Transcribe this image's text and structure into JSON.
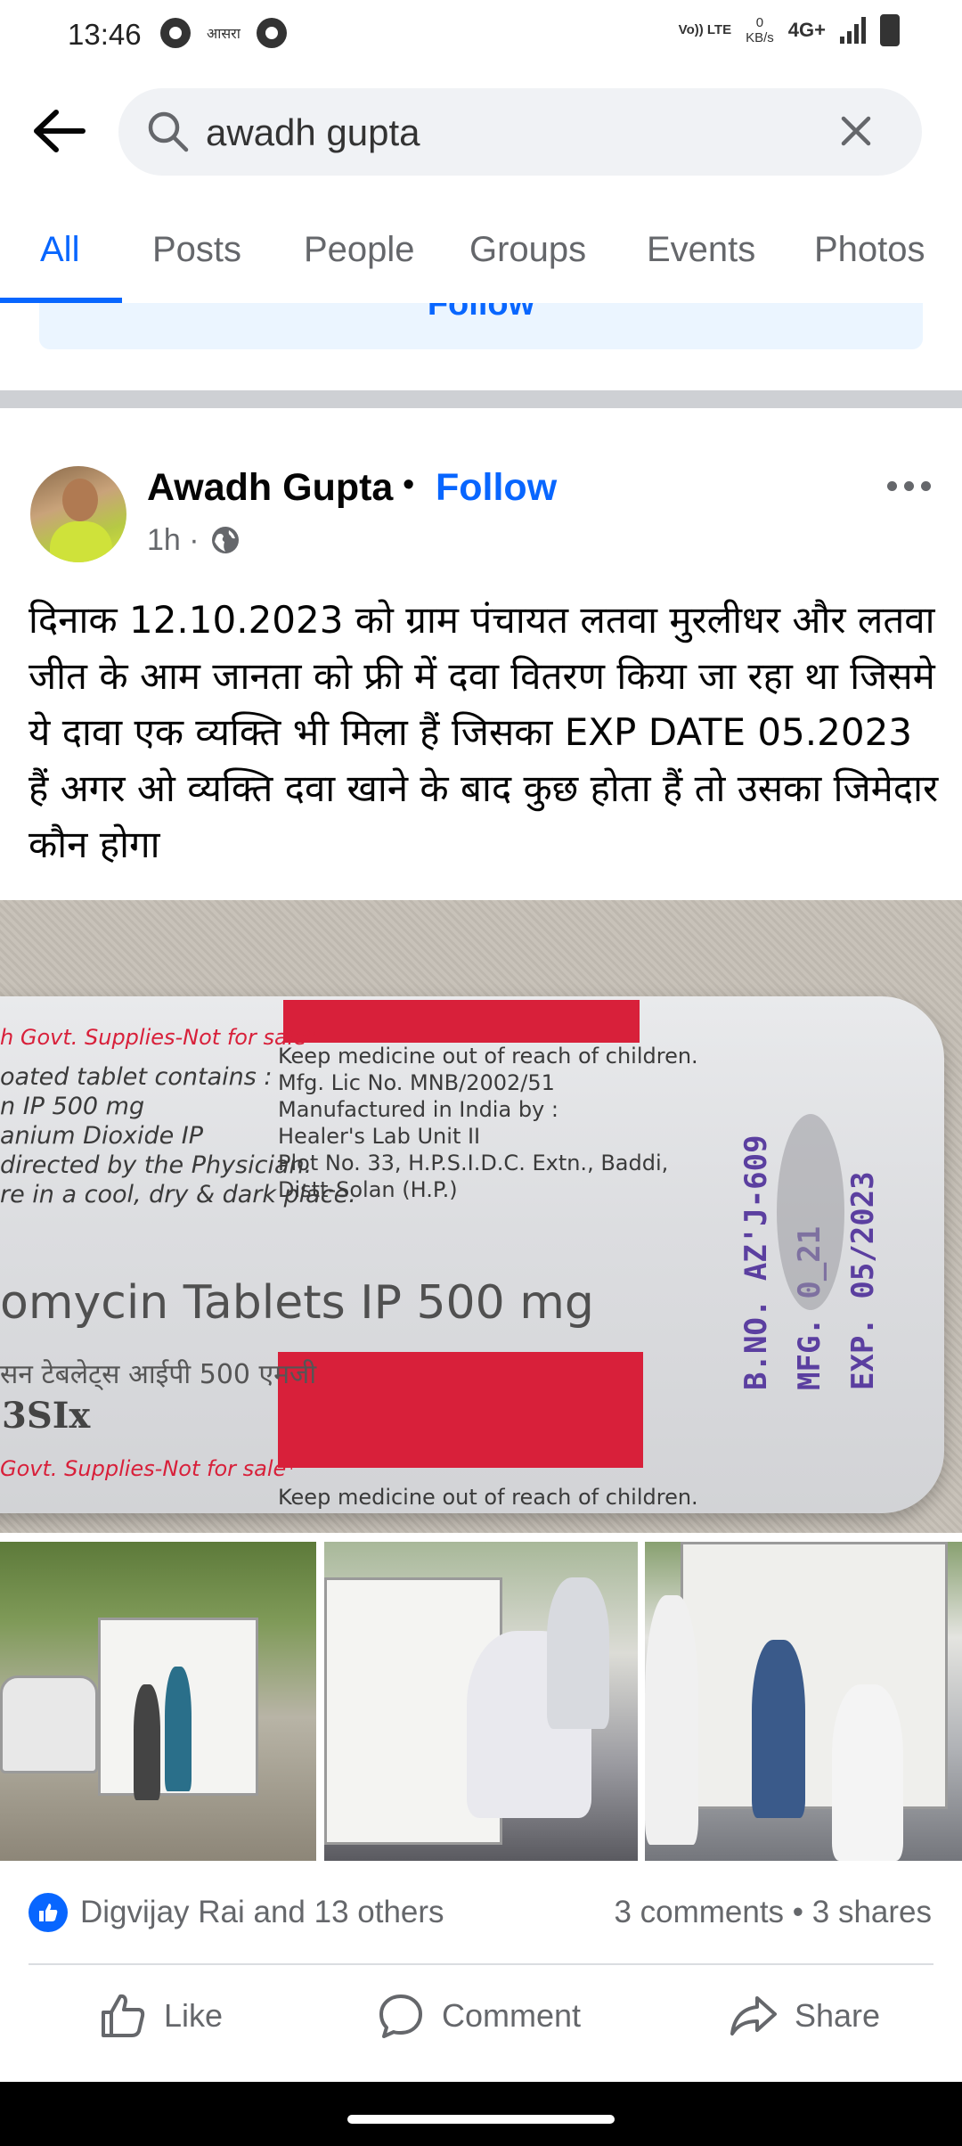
{
  "status_bar": {
    "time": "13:46",
    "left_small_text": "आसरा",
    "lte_label": "Vo)) LTE",
    "data_rate_value": "0",
    "data_rate_unit": "KB/s",
    "network": "4G+"
  },
  "search": {
    "query": "awadh gupta"
  },
  "tabs": [
    {
      "label": "All",
      "active": true
    },
    {
      "label": "Posts"
    },
    {
      "label": "People"
    },
    {
      "label": "Groups"
    },
    {
      "label": "Events"
    },
    {
      "label": "Photos"
    }
  ],
  "previous_card": {
    "follow_label": "Follow"
  },
  "post": {
    "author": "Awadh Gupta",
    "separator": "•",
    "follow_label": "Follow",
    "time": "1h ·",
    "text": "दिनाक 12.10.2023 को ग्राम पंचायत लतवा मुरलीधर और लतवा जीत के आम जानता को फ्री में दवा वितरण किया जा रहा था जिसमे ये दावा एक व्यक्ति भी मिला हैं जिसका EXP DATE 05.2023 हैं अगर ओ व्यक्ति दवा खाने के बाद कुछ होता हैं तो उसका जिमेदार कौन होगा",
    "photo_text": {
      "supplies_top": "h Govt. Supplies-Not for sale*",
      "left_lines": [
        "oated tablet contains :",
        "n IP                500 mg",
        "anium Dioxide IP",
        "directed by the Physician.",
        "re in a cool, dry & dark place."
      ],
      "mid_lines": [
        "Keep medicine out of reach of children.",
        "Mfg. Lic No.      MNB/2002/51",
        "Manufactured in India by :",
        "Healer's Lab Unit II",
        "Plot No. 33, H.P.S.I.D.C. Extn., Baddi,",
        "Distt-Solan (H.P.)"
      ],
      "drug_name": "omycin Tablets IP 500 mg",
      "hindi_line": "सन टेबलेट्स आईपी 500 एमजी",
      "logo": "3SIx",
      "supplies_bottom": "Govt. Supplies-Not for sale*",
      "bottom_line": "Keep medicine out of reach of children.",
      "stamp_lines": [
        "B.NO. AZ'J-609",
        "MFG. 0_21",
        "EXP. 05/2023"
      ]
    },
    "reactions_text": "Digvijay Rai and 13 others",
    "engagement_text": "3 comments • 3 shares",
    "actions": {
      "like": "Like",
      "comment": "Comment",
      "share": "Share"
    }
  },
  "colors": {
    "accent": "#0866ff",
    "secondary_text": "#65676b",
    "separator": "#ced0d4",
    "strip_red": "#d8203a",
    "stamp_purple": "#5b3fa0"
  }
}
